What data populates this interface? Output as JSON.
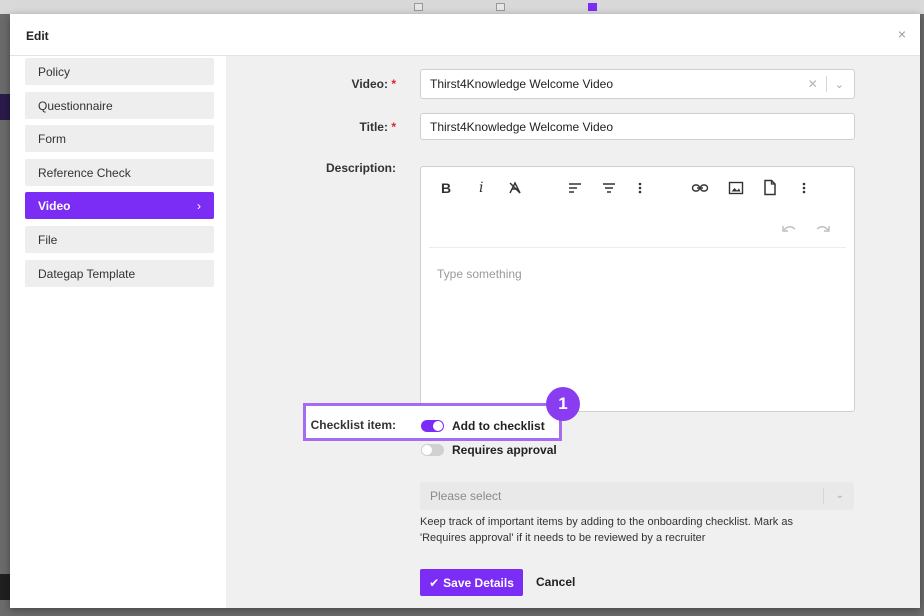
{
  "modal": {
    "title": "Edit",
    "close_icon": "×"
  },
  "sidebar": {
    "items": [
      {
        "label": "Policy"
      },
      {
        "label": "Questionnaire"
      },
      {
        "label": "Form"
      },
      {
        "label": "Reference Check"
      },
      {
        "label": "Video",
        "active": true
      },
      {
        "label": "File"
      },
      {
        "label": "Dategap Template"
      }
    ]
  },
  "form": {
    "video_label": "Video:",
    "video_value": "Thirst4Knowledge Welcome Video",
    "title_label": "Title:",
    "title_value": "Thirst4Knowledge Welcome Video",
    "required_mark": "*",
    "description_label": "Description:",
    "editor_placeholder": "Type something",
    "checklist_label": "Checklist item:",
    "add_to_checklist": "Add to checklist",
    "add_to_checklist_on": true,
    "requires_approval": "Requires approval",
    "requires_approval_on": false,
    "approver_placeholder": "Please select",
    "help_text": "Keep track of important items by adding to the onboarding checklist. Mark as 'Requires approval' if it needs to be reviewed by a recruiter",
    "save_label": "Save Details",
    "cancel_label": "Cancel"
  },
  "annotation": {
    "badge_number": "1"
  },
  "colors": {
    "accent": "#7b2cf5",
    "highlight": "#a66cf0",
    "required": "#d9262c"
  }
}
